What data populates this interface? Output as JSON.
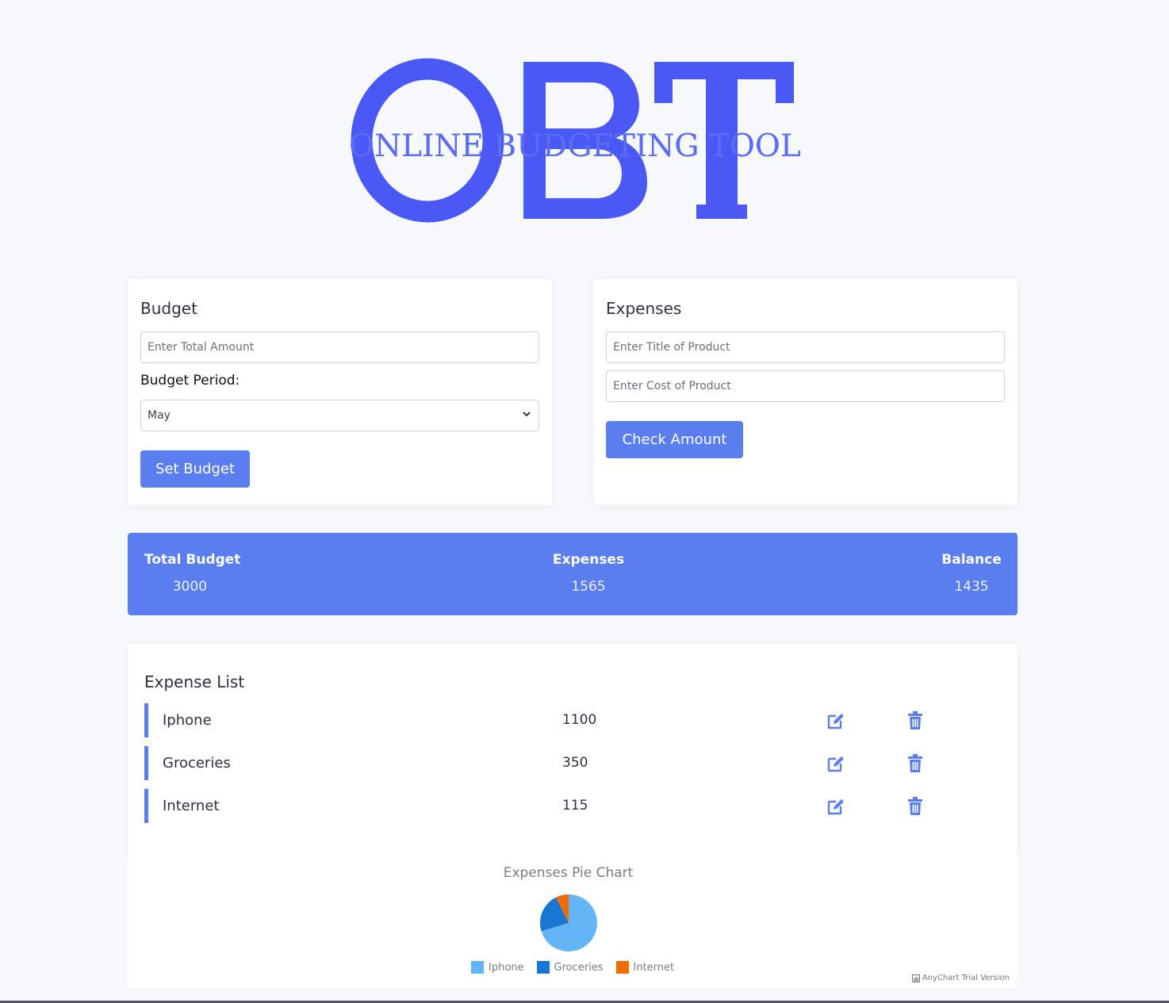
{
  "logo": {
    "letters": "OBT",
    "tagline": "ONLINE BUDGETING TOOL",
    "color": "#4a59f6"
  },
  "budget": {
    "heading": "Budget",
    "amount_placeholder": "Enter Total Amount",
    "period_label": "Budget Period:",
    "period_selected": "May",
    "set_button": "Set Budget"
  },
  "expenses": {
    "heading": "Expenses",
    "title_placeholder": "Enter Title of Product",
    "cost_placeholder": "Enter Cost of Product",
    "check_button": "Check Amount"
  },
  "summary": {
    "total_label": "Total Budget",
    "total_value": "3000",
    "expenses_label": "Expenses",
    "expenses_value": "1565",
    "balance_label": "Balance",
    "balance_value": "1435"
  },
  "expense_list": {
    "heading": "Expense List",
    "items": [
      {
        "title": "Iphone",
        "amount": "1100"
      },
      {
        "title": "Groceries",
        "amount": "350"
      },
      {
        "title": "Internet",
        "amount": "115"
      }
    ],
    "edit_icon": "edit-icon",
    "delete_icon": "trash-icon"
  },
  "chart_data": {
    "type": "pie",
    "title": "Expenses Pie Chart",
    "categories": [
      "Iphone",
      "Groceries",
      "Internet"
    ],
    "values": [
      1100,
      350,
      115
    ],
    "colors": [
      "#64b5f6",
      "#1976d2",
      "#ef6c00"
    ],
    "legend_position": "bottom"
  },
  "credit": "AnyChart Trial Version",
  "colors": {
    "accent": "#5a7ef0",
    "background": "#f7f8fc"
  }
}
